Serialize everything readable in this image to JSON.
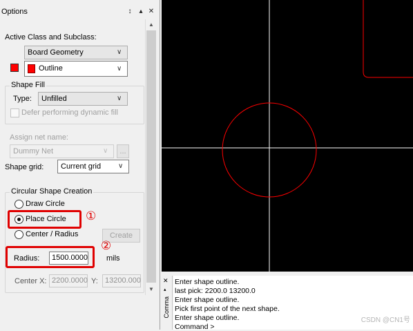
{
  "panel": {
    "title": "Options",
    "pin_icon": "pin-icon",
    "up_icon": "up-arrow-icon",
    "close_icon": "close-icon",
    "active_class_label": "Active Class and Subclass:",
    "class_value": "Board Geometry",
    "subclass_value": "Outline",
    "subclass_color": "#ff0000",
    "shape_fill": {
      "group_title": "Shape Fill",
      "type_label": "Type:",
      "type_value": "Unfilled",
      "defer_label": "Defer performing dynamic fill"
    },
    "assign_net": {
      "label": "Assign net name:",
      "value": "Dummy Net",
      "browse_label": "..."
    },
    "shape_grid": {
      "label": "Shape grid:",
      "value": "Current grid"
    },
    "circular": {
      "group_title": "Circular Shape Creation",
      "options": [
        "Draw Circle",
        "Place Circle",
        "Center / Radius"
      ],
      "selected": "Place Circle",
      "create_label": "Create",
      "radius_label": "Radius:",
      "radius_value": "1500.0000",
      "radius_unit": "mils",
      "center_x_label": "Center X:",
      "center_x_value": "2200.0000",
      "y_label": "Y:",
      "y_value": "13200.000"
    },
    "annotations": [
      "①",
      "②"
    ],
    "highlight_color": "#e00000"
  },
  "canvas": {
    "background": "#000000",
    "crosshair_color": "#ffffff",
    "shape_color": "#ff0000"
  },
  "command": {
    "title": "Comma",
    "close_icon": "close-icon",
    "lines": [
      "Enter shape outline.",
      "last pick:  2200.0 13200.0",
      "Enter shape outline.",
      "Pick first point of the next shape.",
      "Enter shape outline.",
      "Command >"
    ]
  },
  "watermark": "CSDN @CN1号"
}
